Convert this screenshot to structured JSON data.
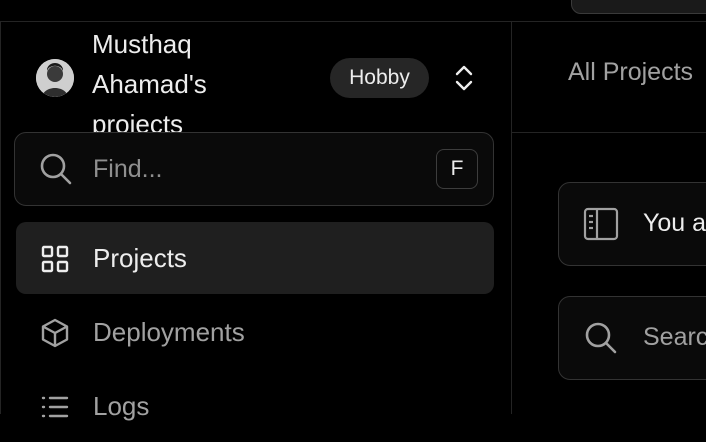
{
  "team_switcher": {
    "name": "Musthaq Ahamad's projects",
    "plan_badge": "Hobby"
  },
  "sidebar_search": {
    "placeholder": "Find...",
    "shortcut": "F"
  },
  "nav": {
    "items": [
      {
        "label": "Projects",
        "icon": "grid-icon",
        "active": true
      },
      {
        "label": "Deployments",
        "icon": "cube-icon",
        "active": false
      },
      {
        "label": "Logs",
        "icon": "list-icon",
        "active": false
      }
    ]
  },
  "main": {
    "tab_label": "All Projects",
    "notice_text": "You a",
    "search_placeholder": "Searc"
  },
  "colors": {
    "background": "#000000",
    "border": "#333333",
    "active_bg": "#1f1f1f",
    "badge_bg": "#262626",
    "text_primary": "#ededed",
    "text_secondary": "#a1a1a1"
  }
}
